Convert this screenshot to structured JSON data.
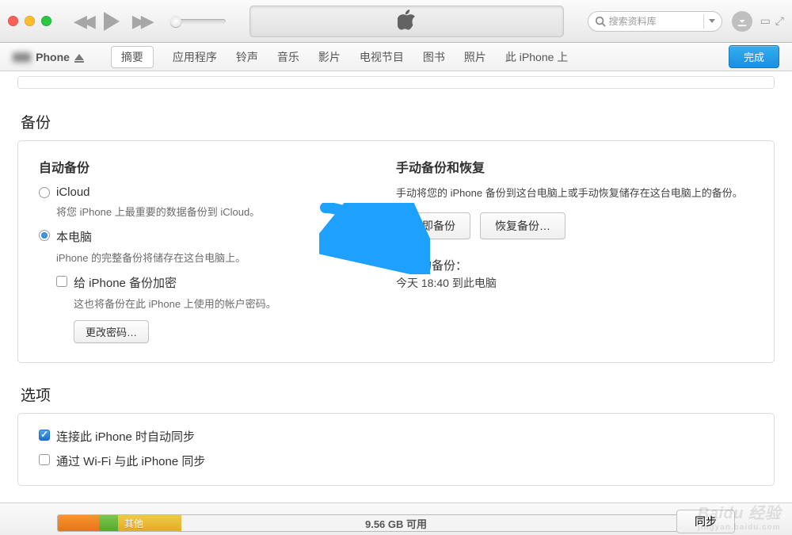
{
  "titlebar": {
    "search_placeholder": "搜索资料库"
  },
  "tabbar": {
    "device_name_blur": "▮▮▮",
    "device_name": "Phone",
    "tabs": [
      "摘要",
      "应用程序",
      "铃声",
      "音乐",
      "影片",
      "电视节目",
      "图书",
      "照片",
      "此 iPhone 上"
    ],
    "done": "完成"
  },
  "backup": {
    "heading": "备份",
    "auto": {
      "title": "自动备份",
      "icloud_label": "iCloud",
      "icloud_desc": "将您 iPhone 上最重要的数据备份到 iCloud。",
      "local_label": "本电脑",
      "local_desc": "iPhone 的完整备份将储存在这台电脑上。",
      "encrypt_label": "给 iPhone 备份加密",
      "encrypt_desc": "这也将备份在此 iPhone 上使用的帐户密码。",
      "change_pw": "更改密码…"
    },
    "manual": {
      "title": "手动备份和恢复",
      "desc": "手动将您的 iPhone 备份到这台电脑上或手动恢复储存在这台电脑上的备份。",
      "backup_now": "立即备份",
      "restore": "恢复备份…",
      "latest_label": "最新的备份：",
      "latest_value": "今天 18:40 到此电脑"
    }
  },
  "options": {
    "heading": "选项",
    "opt1": "连接此 iPhone 时自动同步",
    "opt2": "通过 Wi-Fi 与此 iPhone 同步"
  },
  "footer": {
    "other_label": "其他",
    "free": "9.56 GB 可用",
    "sync": "同步"
  },
  "watermark": {
    "main": "Baidu 经验",
    "sub": "jingyan.baidu.com"
  }
}
